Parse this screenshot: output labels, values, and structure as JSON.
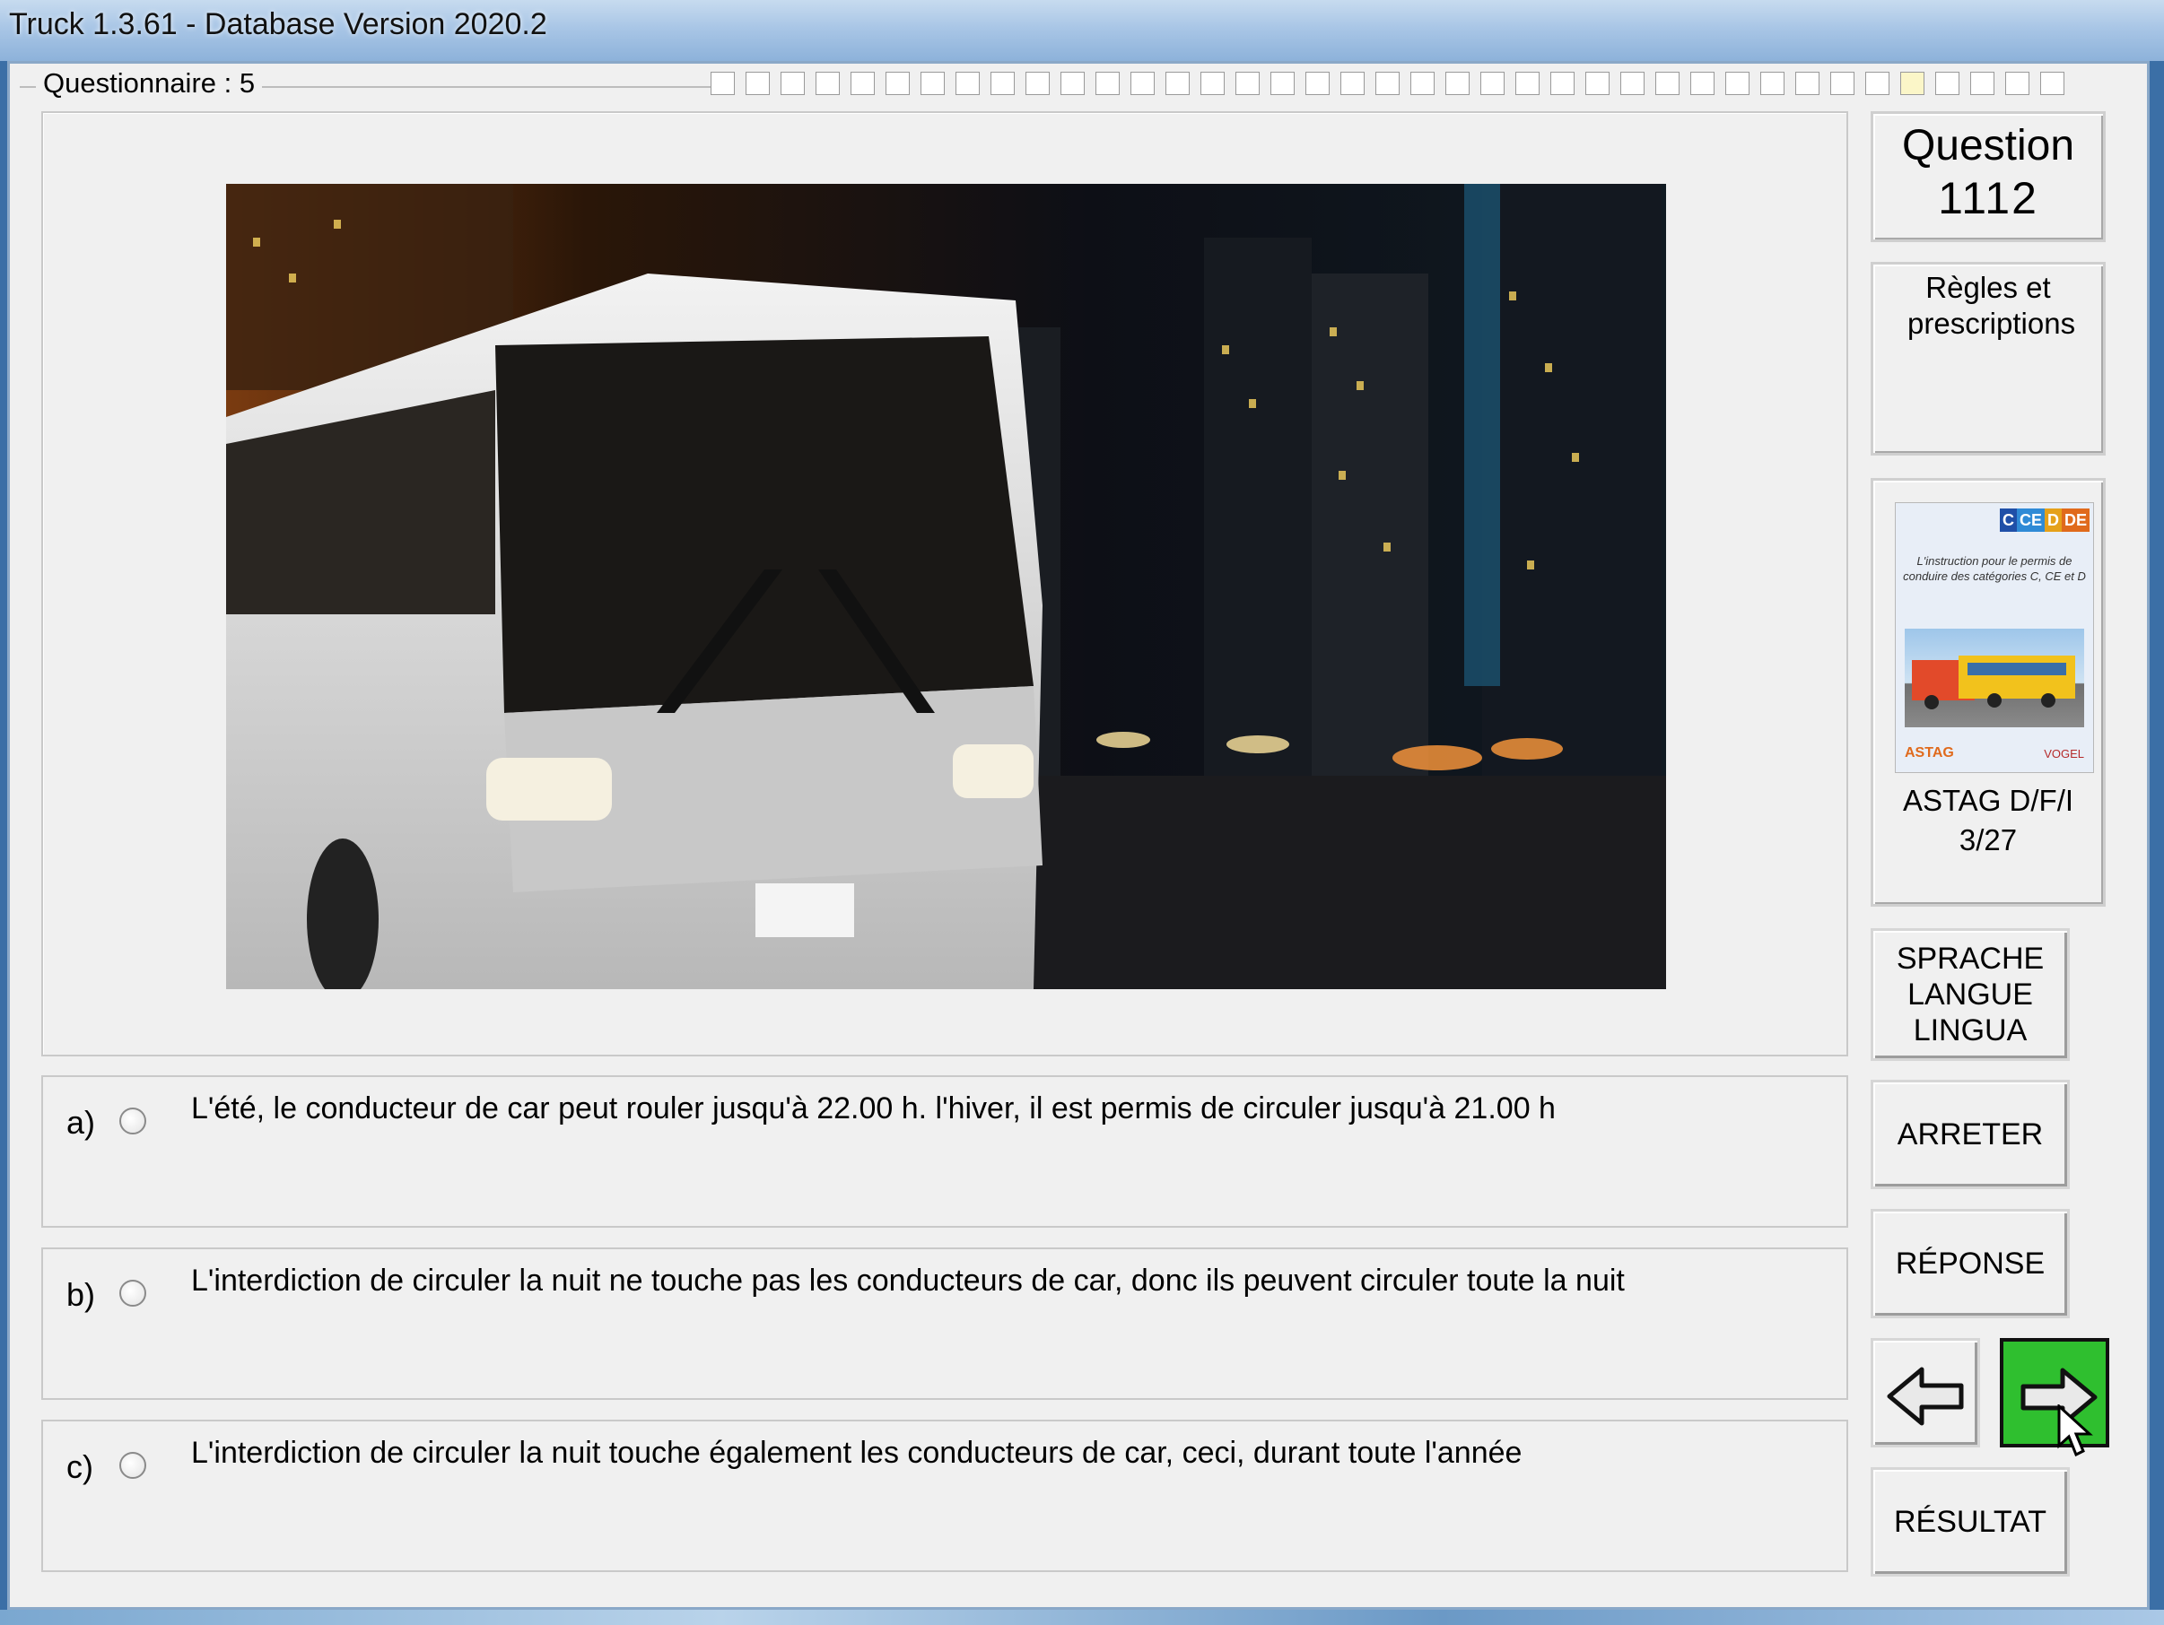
{
  "window": {
    "title": "Truck 1.3.61 - Database Version 2020.2"
  },
  "questionnaire": {
    "label": "Questionnaire : 5"
  },
  "answers": [
    {
      "letter": "a)",
      "text": "L'été, le conducteur de car peut rouler jusqu'à 22.00 h. l'hiver, il est permis de circuler jusqu'à 21.00 h"
    },
    {
      "letter": "b)",
      "text": "L'interdiction de circuler la nuit ne touche pas les conducteurs de car, donc ils peuvent circuler toute la nuit"
    },
    {
      "letter": "c)",
      "text": "L'interdiction de circuler la nuit touche également les conducteurs de car, ceci, durant toute l'année"
    }
  ],
  "sidebar": {
    "question_title": "Question",
    "question_number": "1112",
    "category": "Règles et prescriptions",
    "book": {
      "badges": [
        "C",
        "CE",
        "D",
        "DE"
      ],
      "badge_colors": [
        "#1f4fa8",
        "#2f8ad6",
        "#e5a11a",
        "#e06a1c"
      ],
      "title": "L'instruction pour le permis de conduire des catégories C, CE et D",
      "publisher_left": "ASTAG",
      "publisher_right": "VOGEL"
    },
    "reference_source": "ASTAG D/F/I",
    "reference_page": "3/27",
    "language_button": [
      "SPRACHE",
      "LANGUE",
      "LINGUA"
    ],
    "stop_button": "ARRETER",
    "answer_button": "RÉPONSE",
    "result_button": "RÉSULTAT",
    "prev_icon": "arrow-left-icon",
    "next_icon": "arrow-right-icon",
    "next_color": "#2fbf2f"
  }
}
